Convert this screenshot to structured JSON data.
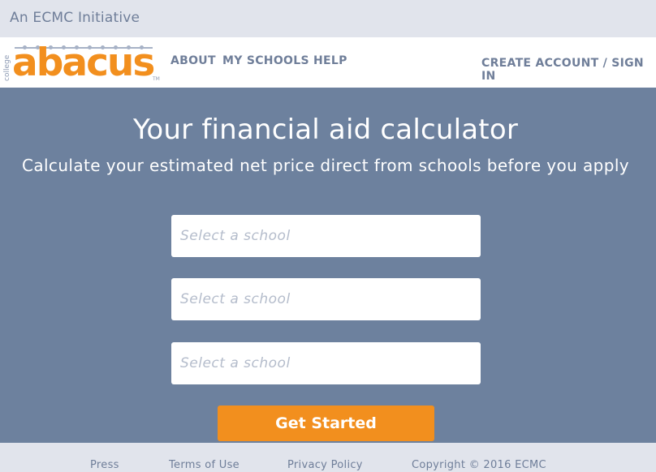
{
  "topbar": {
    "initiative": "An ECMC Initiative"
  },
  "header": {
    "logo": {
      "prefix": "college",
      "wordmark": "abacus",
      "trademark": "TM"
    },
    "nav": {
      "about": "ABOUT",
      "my_schools": "MY SCHOOLS",
      "help": "HELP",
      "account": "CREATE ACCOUNT / SIGN IN"
    }
  },
  "hero": {
    "title": "Your financial aid calculator",
    "subtitle": "Calculate your estimated net price direct from schools before you apply",
    "school_inputs": [
      {
        "placeholder": "Select a school",
        "value": ""
      },
      {
        "placeholder": "Select a school",
        "value": ""
      },
      {
        "placeholder": "Select a school",
        "value": ""
      }
    ],
    "cta": "Get Started"
  },
  "footer": {
    "links": [
      "Press",
      "Terms of Use",
      "Privacy Policy"
    ],
    "copyright": "Copyright © 2016 ECMC"
  },
  "colors": {
    "brand_orange": "#f28f1e",
    "hero_bg": "#6d819e",
    "nav_text": "#6f7e99",
    "top_bg": "#e1e4ec"
  }
}
